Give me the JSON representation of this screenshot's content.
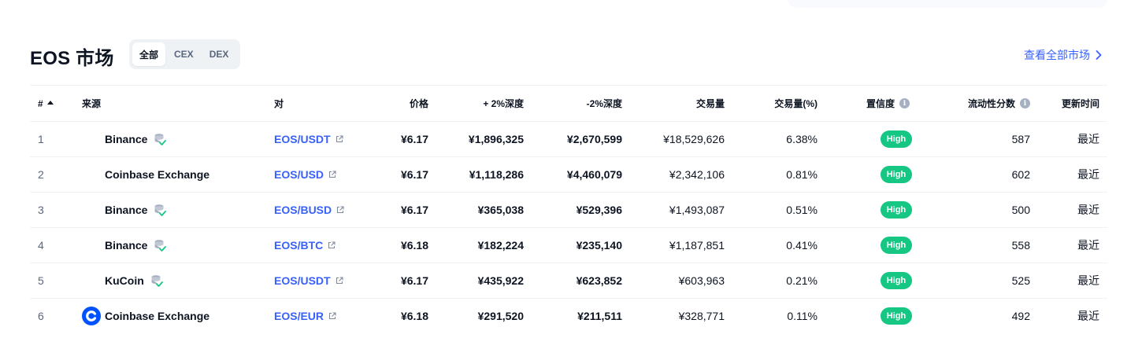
{
  "header": {
    "title": "EOS 市场",
    "filters": [
      {
        "label": "全部",
        "active": true
      },
      {
        "label": "CEX",
        "active": false
      },
      {
        "label": "DEX",
        "active": false
      }
    ],
    "view_all": "查看全部市场"
  },
  "columns": {
    "rank": "#",
    "source": "来源",
    "pair": "对",
    "price": "价格",
    "plus_depth": "+ 2%深度",
    "minus_depth": "-2%深度",
    "volume": "交易量",
    "volume_pct": "交易量(%)",
    "confidence": "置信度",
    "liquidity": "流动性分数",
    "updated": "更新时间"
  },
  "colors": {
    "accent": "#3861fb",
    "high_badge": "#16c784",
    "muted": "#58667e"
  },
  "rows": [
    {
      "rank": "1",
      "source": "Binance",
      "icon": "binance-verify-icon",
      "pair": "EOS/USDT",
      "price": "¥6.17",
      "plus_depth": "¥1,896,325",
      "minus_depth": "¥2,670,599",
      "volume": "¥18,529,626",
      "volume_pct": "6.38%",
      "confidence": "High",
      "liquidity": "587",
      "updated": "最近"
    },
    {
      "rank": "2",
      "source": "Coinbase Exchange",
      "icon": "",
      "pair": "EOS/USD",
      "price": "¥6.17",
      "plus_depth": "¥1,118,286",
      "minus_depth": "¥4,460,079",
      "volume": "¥2,342,106",
      "volume_pct": "0.81%",
      "confidence": "High",
      "liquidity": "602",
      "updated": "最近"
    },
    {
      "rank": "3",
      "source": "Binance",
      "icon": "binance-verify-icon",
      "pair": "EOS/BUSD",
      "price": "¥6.17",
      "plus_depth": "¥365,038",
      "minus_depth": "¥529,396",
      "volume": "¥1,493,087",
      "volume_pct": "0.51%",
      "confidence": "High",
      "liquidity": "500",
      "updated": "最近"
    },
    {
      "rank": "4",
      "source": "Binance",
      "icon": "binance-verify-icon",
      "pair": "EOS/BTC",
      "price": "¥6.18",
      "plus_depth": "¥182,224",
      "minus_depth": "¥235,140",
      "volume": "¥1,187,851",
      "volume_pct": "0.41%",
      "confidence": "High",
      "liquidity": "558",
      "updated": "最近"
    },
    {
      "rank": "5",
      "source": "KuCoin",
      "icon": "kucoin-verify-icon",
      "pair": "EOS/USDT",
      "price": "¥6.17",
      "plus_depth": "¥435,922",
      "minus_depth": "¥623,852",
      "volume": "¥603,963",
      "volume_pct": "0.21%",
      "confidence": "High",
      "liquidity": "525",
      "updated": "最近"
    },
    {
      "rank": "6",
      "source": "Coinbase Exchange",
      "icon": "coinbase-logo-icon",
      "pair": "EOS/EUR",
      "price": "¥6.18",
      "plus_depth": "¥291,520",
      "minus_depth": "¥211,511",
      "volume": "¥328,771",
      "volume_pct": "0.11%",
      "confidence": "High",
      "liquidity": "492",
      "updated": "最近"
    }
  ]
}
